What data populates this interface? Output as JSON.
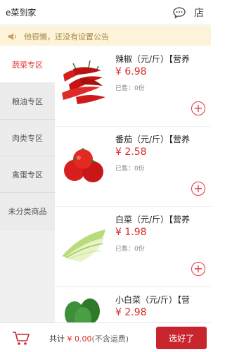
{
  "header": {
    "title": "e菜到家",
    "chat_icon": "chat-bubble-icon",
    "shop_label": "店"
  },
  "notice": {
    "icon": "speaker-icon",
    "text": "他很懒，还没有设置公告"
  },
  "sidebar": {
    "items": [
      {
        "label": "蔬菜专区",
        "active": true
      },
      {
        "label": "粮油专区"
      },
      {
        "label": "肉类专区"
      },
      {
        "label": "禽蛋专区"
      },
      {
        "label": "未分类商品"
      }
    ]
  },
  "products": [
    {
      "name": "辣椒（元/斤）【营养",
      "price": "¥ 6.98",
      "sold": "已售：0份"
    },
    {
      "name": "番茄（元/斤）【营养",
      "price": "¥ 2.58",
      "sold": "已售：0份"
    },
    {
      "name": "白菜（元/斤）【营养",
      "price": "¥ 1.98",
      "sold": "已售：0份"
    },
    {
      "name": "小白菜（元/斤）【营",
      "price": "¥ 2.98",
      "sold": ""
    }
  ],
  "add_label": "+",
  "footer": {
    "total_label": "共计 ",
    "amount": "¥ 0.00",
    "note": "(不含运费)",
    "submit_label": "选好了"
  },
  "colors": {
    "accent": "#c9252e",
    "price": "#d62b2b",
    "notice_bg": "#fdf3d8"
  }
}
